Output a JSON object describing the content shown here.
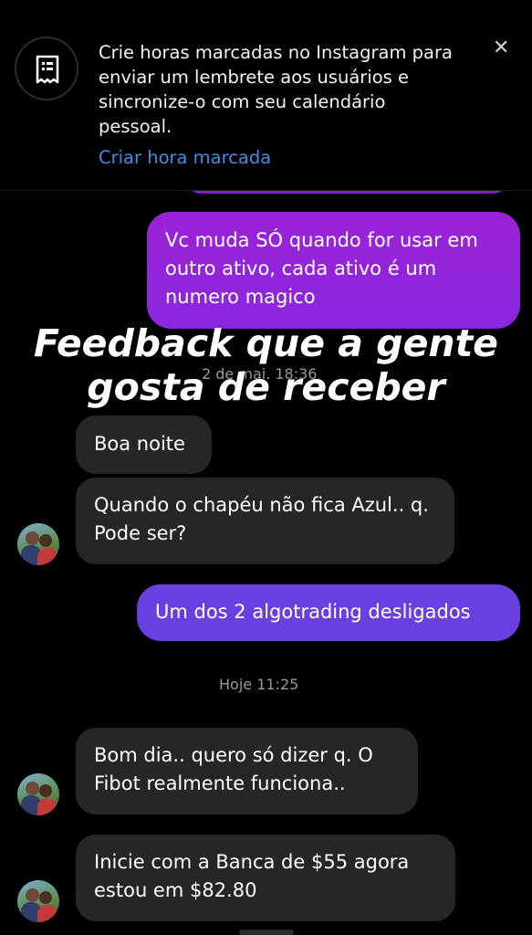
{
  "banner": {
    "text": "Crie horas marcadas no Instagram para enviar um lembrete aos usuários e sincronize-o com seu calendário pessoal.",
    "link": "Criar hora marcada",
    "icon": "calendar-receipt-icon",
    "close_icon": "close-icon"
  },
  "overlay": {
    "line1": "Feedback que a gente",
    "line2": "gosta de receber"
  },
  "messages": [
    {
      "type": "sent",
      "text": "Vc muda SÓ quando for usar em outro ativo, cada ativo é um numero magico"
    },
    {
      "type": "timestamp",
      "text": "2 de mai. 18:36"
    },
    {
      "type": "received",
      "text": "Boa noite"
    },
    {
      "type": "received",
      "text": "Quando o chapéu não fica Azul.. q. Pode ser?"
    },
    {
      "type": "sent",
      "text": "Um dos 2 algotrading desligados"
    },
    {
      "type": "timestamp",
      "text": "Hoje 11:25"
    },
    {
      "type": "received",
      "text": "Bom dia.. quero só dizer q. O Fibot realmente funciona.."
    },
    {
      "type": "received",
      "text": "Inicie com a Banca de $55 agora estou em $82.80"
    }
  ],
  "colors": {
    "background": "#000000",
    "received_bubble": "#262626",
    "sent_bubble_purple": "#9b22d6",
    "sent_bubble_violet": "#6a3fe0",
    "link": "#3f8ee6"
  }
}
